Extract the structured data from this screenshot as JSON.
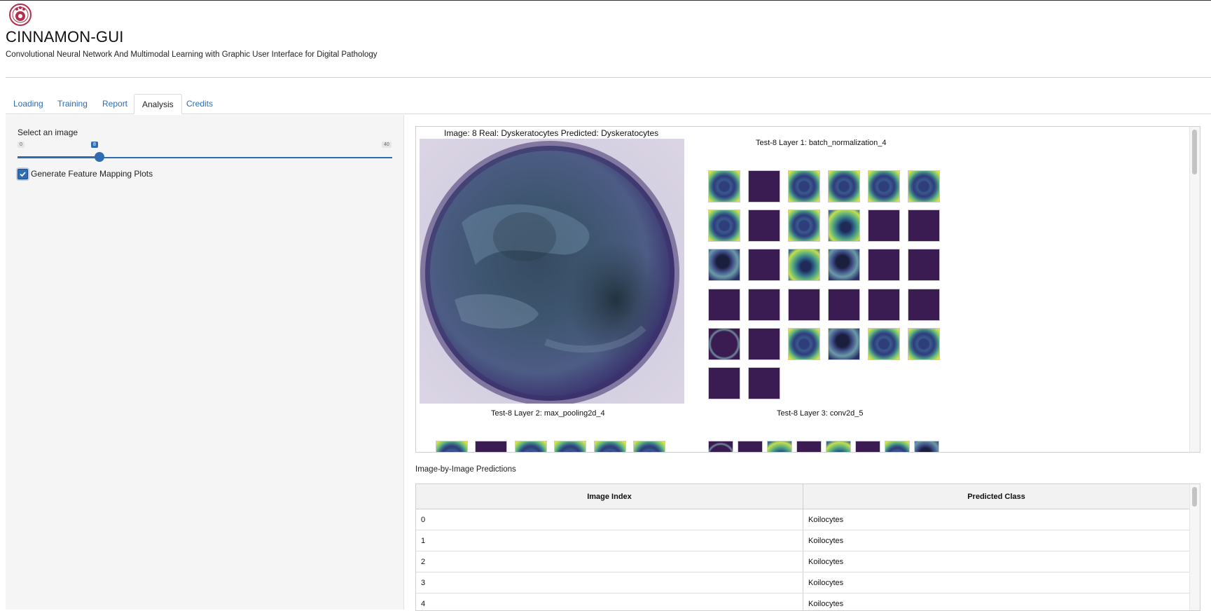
{
  "app": {
    "title": "CINNAMON-GUI",
    "subtitle": "Convolutional Neural Network And Multimodal Learning with Graphic User Interface for Digital Pathology"
  },
  "tabs": [
    {
      "label": "Loading",
      "active": false
    },
    {
      "label": "Training",
      "active": false
    },
    {
      "label": "Report",
      "active": false
    },
    {
      "label": "Analysis",
      "active": true
    },
    {
      "label": "Credits",
      "active": false
    }
  ],
  "sidebar": {
    "slider": {
      "label": "Select an image",
      "min": "0",
      "max": "40",
      "value": "8"
    },
    "checkbox": {
      "label": "Generate Feature Mapping Plots",
      "checked": true
    }
  },
  "plots": {
    "main_title": "Image: 8 Real: Dyskeratocytes Predicted: Dyskeratocytes",
    "layer1_title": "Test-8 Layer 1: batch_normalization_4",
    "layer2_title": "Test-8 Layer 2: max_pooling2d_4",
    "layer3_title": "Test-8 Layer 3: conv2d_5"
  },
  "predictions": {
    "label": "Image-by-Image Predictions",
    "columns": [
      "Image Index",
      "Predicted Class"
    ],
    "rows": [
      [
        "0",
        "Koilocytes"
      ],
      [
        "1",
        "Koilocytes"
      ],
      [
        "2",
        "Koilocytes"
      ],
      [
        "3",
        "Koilocytes"
      ],
      [
        "4",
        "Koilocytes"
      ]
    ]
  },
  "colors": {
    "accent": "#2f6cb3",
    "link": "#2a6db5",
    "feature_map_dark": "#3b1c52",
    "logo": "#b3304c"
  }
}
